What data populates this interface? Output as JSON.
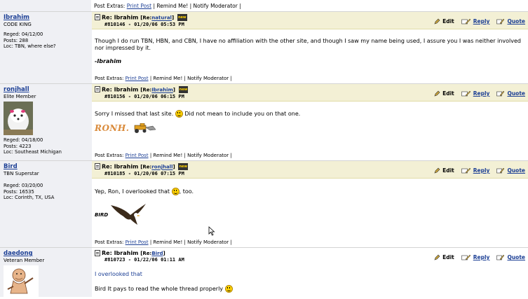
{
  "top_extras": {
    "prefix": "Post Extras:",
    "print_post": "Print Post",
    "remind": "| Remind Me! |",
    "notify": "Notify Moderator |"
  },
  "actions": {
    "edit": "Edit",
    "reply": "Reply",
    "quote": "Quote"
  },
  "extras_labels": {
    "prefix": "Post Extras:",
    "print_post": "Print Post",
    "remind": "| Remind Me! |",
    "notify": "Notify Moderator |"
  },
  "posts": [
    {
      "username": "Ibrahim",
      "user_title": "CODE KING",
      "reged": "Reged: 04/12/00",
      "posts": "Posts: 288",
      "loc": "Loc: TBN, where else?",
      "subject_prefix": "Re: Ibrahim",
      "re_label": "[Re:",
      "re_link": "natural",
      "re_close": "]",
      "post_num": "#810146 - 01/20/06 05:53 PM",
      "body_text": "Though I do run TBN, HBN, and CBN, I have no affiliation with the other site, and though I saw my name being used, I assure you I was neither involved nor impressed by it.",
      "signature": "-Ibrahim"
    },
    {
      "username": "ronjhall",
      "user_title": "Elite Member",
      "reged": "Reged: 04/18/00",
      "posts": "Posts: 4223",
      "loc": "Loc: Southeast Michigan",
      "subject_prefix": "Re: Ibrahim",
      "re_label": "[Re:",
      "re_link": "Ibrahim",
      "re_close": "]",
      "post_num": "#810156 - 01/20/06 06:15 PM",
      "body_text_1": "Sorry I missed that last site.",
      "body_text_2": "Did not mean to include you on that one.",
      "sig_image_text": "RONH."
    },
    {
      "username": "Bird",
      "user_title": "TBN Superstar",
      "reged": "Reged: 03/20/00",
      "posts": "Posts: 16535",
      "loc": "Loc: Corinth, TX, USA",
      "subject_prefix": "Re: Ibrahim",
      "re_label": "[Re:",
      "re_link": "ronjhall",
      "re_close": "]",
      "post_num": "#810185 - 01/20/06 07:15 PM",
      "body_text_1": "Yep, Ron, I overlooked that",
      "body_text_2": ", too.",
      "sig_image_text": "BIRD"
    },
    {
      "username": "daedong",
      "user_title": "Veteran Member",
      "subject_prefix": "Re: Ibrahim",
      "re_label": "[Re:",
      "re_link": "Bird",
      "re_close": "]",
      "post_num": "#810723 - 01/22/06 01:11 AM",
      "quote_text": "I overlooked that",
      "body_text": "Bird It pays to read the whole thread properly"
    }
  ],
  "colors": {
    "link": "#1c3f95",
    "header_bg": "#f3f0d5",
    "side_bg": "#eff0f4"
  },
  "icons": [
    "document-icon",
    "edit-icon",
    "reply-icon",
    "quote-icon",
    "smiley-icon",
    "mouse-cursor-icon"
  ]
}
